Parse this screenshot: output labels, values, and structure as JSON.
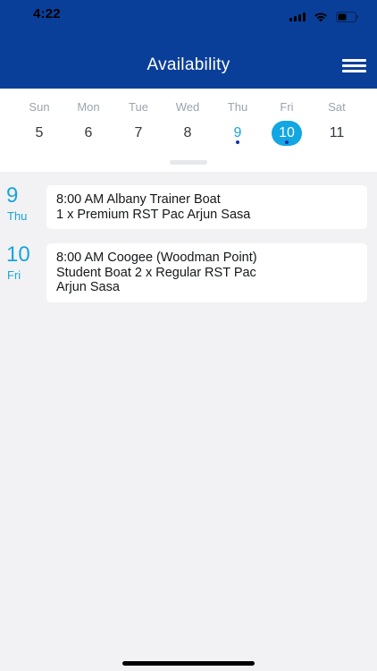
{
  "status_bar": {
    "time": "4:22"
  },
  "header": {
    "title": "Availability",
    "background_color": "#0a3f99",
    "menu_icon": "hamburger-menu-icon"
  },
  "week": {
    "days": [
      {
        "name": "Sun",
        "number": "5",
        "has_event": false,
        "selected": false
      },
      {
        "name": "Mon",
        "number": "6",
        "has_event": false,
        "selected": false
      },
      {
        "name": "Tue",
        "number": "7",
        "has_event": false,
        "selected": false
      },
      {
        "name": "Wed",
        "number": "8",
        "has_event": false,
        "selected": false
      },
      {
        "name": "Thu",
        "number": "9",
        "has_event": true,
        "selected": false
      },
      {
        "name": "Fri",
        "number": "10",
        "has_event": true,
        "selected": true
      },
      {
        "name": "Sat",
        "number": "11",
        "has_event": false,
        "selected": false
      }
    ],
    "accent_color": "#12a6e3",
    "dot_color": "#1232a8"
  },
  "agenda": [
    {
      "date_number": "9",
      "date_day": "Thu",
      "lines": [
        "8:00 AM Albany Trainer Boat",
        "1 x Premium RST Pac Arjun Sasa"
      ]
    },
    {
      "date_number": "10",
      "date_day": "Fri",
      "lines": [
        "8:00 AM Coogee (Woodman Point)",
        "Student Boat 2 x Regular RST Pac",
        "Arjun Sasa"
      ]
    }
  ]
}
